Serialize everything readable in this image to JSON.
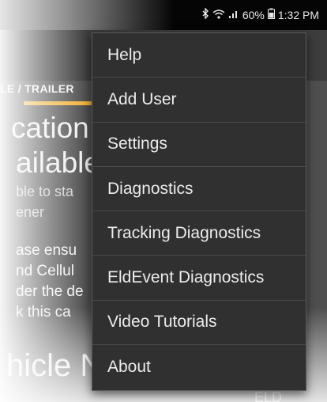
{
  "status_bar": {
    "icons": [
      "bluetooth-icon",
      "wifi-icon",
      "signal-icon",
      "battery-icon"
    ],
    "battery": "60%",
    "time": "1:32 PM"
  },
  "background": {
    "tab_label": "LE / TRAILER",
    "heading_lines": [
      "cation",
      "ailable"
    ],
    "sub_lines": [
      "ble to sta",
      "ener"
    ],
    "body_lines": [
      "ase ensu",
      "nd Cellul",
      "der the de",
      "k this ca"
    ],
    "bottom_title": "hicle No",
    "corner_label": "ELD"
  },
  "menu": {
    "items": [
      {
        "label": "Help"
      },
      {
        "label": "Add User"
      },
      {
        "label": "Settings"
      },
      {
        "label": "Diagnostics"
      },
      {
        "label": "Tracking Diagnostics"
      },
      {
        "label": "EldEvent Diagnostics"
      },
      {
        "label": "Video Tutorials"
      },
      {
        "label": "About"
      }
    ]
  },
  "colors": {
    "menu_bg": "#303030",
    "accent": "#f0b33a",
    "status_bar": "#050505"
  }
}
